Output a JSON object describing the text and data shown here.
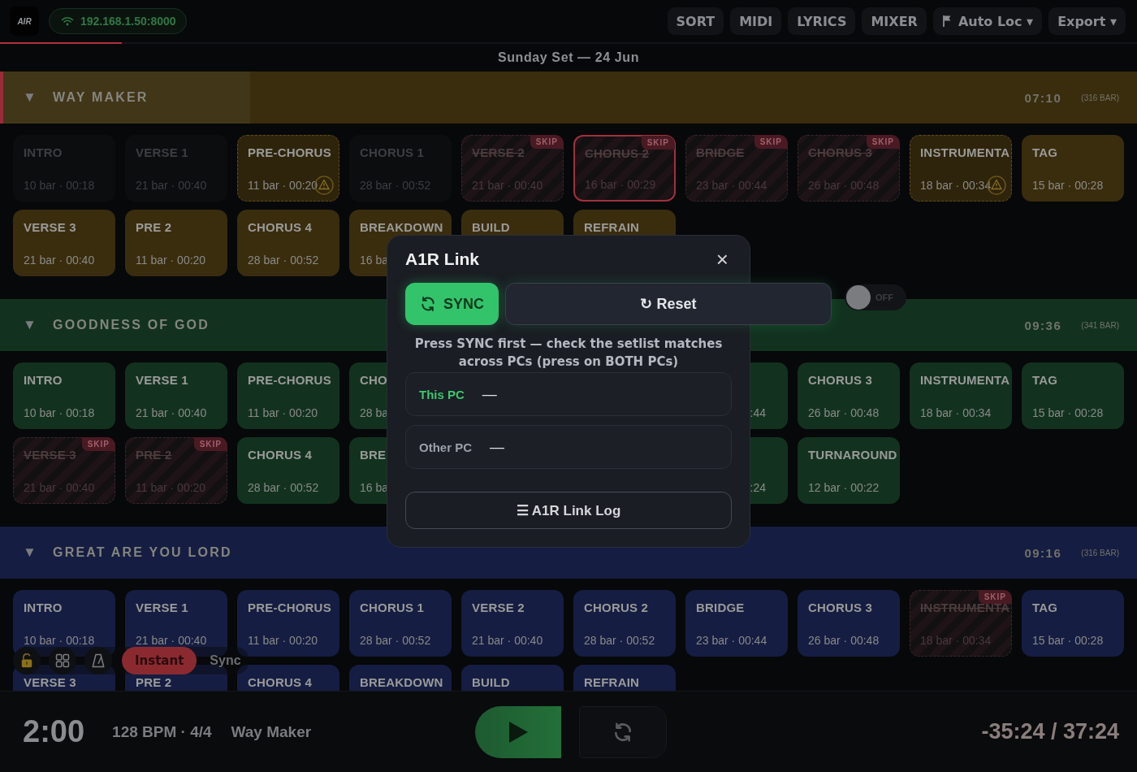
{
  "topbar": {
    "logo": "AIR",
    "address": "192.168.1.50:8000",
    "buttons": [
      {
        "label": "SORT",
        "kind": "plain"
      },
      {
        "label": "MIDI",
        "kind": "plain"
      },
      {
        "label": "LYRICS",
        "kind": "plain"
      },
      {
        "label": "MIXER",
        "kind": "plain"
      },
      {
        "label": "Auto Loc ▾",
        "kind": "flag"
      },
      {
        "label": "Export ▾",
        "kind": "plain"
      }
    ]
  },
  "progress": {
    "level": 0.107
  },
  "set_title": "Sunday Set — 24 Jun",
  "sections": [
    {
      "arrow": "▼",
      "title": "WAY MAKER",
      "time": "07:10",
      "bars": "(316 BAR)",
      "color": "#3a2d0e",
      "selected": true,
      "level": 0.218,
      "rows": [
        [
          {
            "title": "INTRO",
            "meta": "10 bar · 00:18",
            "kind": "played",
            "selected": false
          },
          {
            "title": "VERSE 1",
            "meta": "21 bar · 00:40",
            "kind": "played",
            "selected": false
          },
          {
            "title": "PRE-CHORUS",
            "meta": "11 bar · 00:20",
            "kind": "warning",
            "selected": false
          },
          {
            "title": "CHORUS 1",
            "meta": "28 bar · 00:52",
            "kind": "played",
            "selected": false
          },
          {
            "title": "VERSE 2",
            "meta": "21 bar · 00:40",
            "kind": "skip",
            "badge": "SKIP",
            "selected": false
          },
          {
            "title": "CHORUS 2",
            "meta": "16 bar · 00:29",
            "kind": "skip",
            "badge": "SKIP",
            "selected": true
          },
          {
            "title": "BRIDGE",
            "meta": "23 bar · 00:44",
            "kind": "skip",
            "badge": "SKIP",
            "selected": false
          },
          {
            "title": "CHORUS 3",
            "meta": "26 bar · 00:48",
            "kind": "skip",
            "badge": "SKIP",
            "selected": false
          },
          {
            "title": "INSTRUMENTA",
            "meta": "18 bar · 00:34",
            "kind": "warning",
            "selected": false
          },
          {
            "title": "TAG",
            "meta": "15 bar · 00:28",
            "kind": "normal",
            "selected": false
          }
        ],
        [
          {
            "title": "VERSE 3",
            "meta": "21 bar · 00:40",
            "kind": "normal",
            "selected": false
          },
          {
            "title": "PRE 2",
            "meta": "11 bar · 00:20",
            "kind": "normal",
            "selected": false
          },
          {
            "title": "CHORUS 4",
            "meta": "28 bar · 00:52",
            "kind": "normal",
            "selected": false
          },
          {
            "title": "BREAKDOWN",
            "meta": "16 ba",
            "kind": "normal",
            "selected": false
          },
          {
            "title": "BUILD",
            "kind": "normal",
            "selected": false
          },
          {
            "title": "REFRAIN",
            "kind": "normal",
            "selected": false
          }
        ]
      ]
    },
    {
      "arrow": "▼",
      "title": "GOODNESS OF GOD",
      "time": "09:36",
      "bars": "(341 BAR)",
      "color": "#12321f",
      "selected": false,
      "rows": [
        [
          {
            "title": "INTRO",
            "meta": "10 bar · 00:18",
            "kind": "normal",
            "selected": false
          },
          {
            "title": "VERSE 1",
            "meta": "21 bar · 00:40",
            "kind": "normal",
            "selected": false
          },
          {
            "title": "PRE-CHORUS",
            "meta": "11 bar · 00:20",
            "kind": "normal",
            "selected": false
          },
          {
            "title": "CHO",
            "meta": "28 ba",
            "kind": "normal",
            "selected": false
          },
          {
            "kind": "hidden"
          },
          {
            "kind": "hidden"
          },
          {
            "meta": ":44",
            "kind": "edge",
            "selected": false
          },
          {
            "title": "CHORUS 3",
            "meta": "26 bar · 00:48",
            "kind": "normal",
            "selected": false
          },
          {
            "title": "INSTRUMENTA",
            "meta": "18 bar · 00:34",
            "kind": "normal",
            "selected": false
          },
          {
            "title": "TAG",
            "meta": "15 bar · 00:28",
            "kind": "normal",
            "selected": false
          }
        ],
        [
          {
            "title": "VERSE 3",
            "meta": "21 bar · 00:40",
            "kind": "skip",
            "badge": "SKIP",
            "selected": false
          },
          {
            "title": "PRE 2",
            "meta": "11 bar · 00:20",
            "kind": "skip",
            "badge": "SKIP",
            "selected": false
          },
          {
            "title": "CHORUS 4",
            "meta": "28 bar · 00:52",
            "kind": "normal",
            "selected": false
          },
          {
            "title": "BRE",
            "meta": "16 ba",
            "kind": "normal",
            "selected": false
          },
          {
            "kind": "hidden"
          },
          {
            "kind": "hidden"
          },
          {
            "meta": ":24",
            "kind": "edge",
            "selected": false
          },
          {
            "title": "TURNAROUND",
            "meta": "12 bar · 00:22",
            "kind": "normal",
            "selected": false
          }
        ]
      ]
    },
    {
      "arrow": "▼",
      "title": "GREAT ARE YOU LORD",
      "time": "09:16",
      "bars": "(316 BAR)",
      "color": "#151d42",
      "selected": false,
      "rows": [
        [
          {
            "title": "INTRO",
            "meta": "10 bar · 00:18",
            "kind": "normal",
            "selected": false
          },
          {
            "title": "VERSE 1",
            "meta": "21 bar · 00:40",
            "kind": "normal",
            "selected": false
          },
          {
            "title": "PRE-CHORUS",
            "meta": "11 bar · 00:20",
            "kind": "normal",
            "selected": false
          },
          {
            "title": "CHORUS 1",
            "meta": "28 bar · 00:52",
            "kind": "normal",
            "selected": false
          },
          {
            "title": "VERSE 2",
            "meta": "21 bar · 00:40",
            "kind": "normal",
            "selected": false
          },
          {
            "title": "CHORUS 2",
            "meta": "28 bar · 00:52",
            "kind": "normal",
            "selected": false
          },
          {
            "title": "BRIDGE",
            "meta": "23 bar · 00:44",
            "kind": "normal",
            "selected": false
          },
          {
            "title": "CHORUS 3",
            "meta": "26 bar · 00:48",
            "kind": "normal",
            "selected": false
          },
          {
            "title": "INSTRUMENTA",
            "meta": "18 bar · 00:34",
            "kind": "skip",
            "badge": "SKIP",
            "selected": false
          },
          {
            "title": "TAG",
            "meta": "15 bar · 00:28",
            "kind": "normal",
            "selected": false
          }
        ],
        [
          {
            "title": "VERSE 3",
            "kind": "normal",
            "selected": false
          },
          {
            "title": "PRE 2",
            "kind": "normal",
            "selected": false
          },
          {
            "title": "CHORUS 4",
            "kind": "normal",
            "selected": false
          },
          {
            "title": "BREAKDOWN",
            "kind": "normal",
            "selected": false
          },
          {
            "title": "BUILD",
            "kind": "normal",
            "selected": false
          },
          {
            "title": "REFRAIN",
            "kind": "normal",
            "selected": false
          }
        ]
      ]
    }
  ],
  "floating_toolbar": {
    "buttons": [
      {
        "kind": "lock"
      },
      {
        "kind": "grid"
      },
      {
        "kind": "metronome"
      }
    ],
    "mode": "Instant",
    "sync_label": "Sync"
  },
  "transport": {
    "position": "2:00",
    "tempo": "128 BPM · 4/4",
    "song": "Way Maker",
    "time": "-35:24 / 37:24"
  },
  "modal": {
    "title": "A1R Link",
    "close": "×",
    "sync_button": "SYNC",
    "reset_button": "↻ Reset",
    "message": "Press SYNC first — check the setlist matches across PCs (press on BOTH PCs)",
    "rows": [
      {
        "label": "This PC",
        "value": "—",
        "color": "#3cc86a"
      },
      {
        "label": "Other PC",
        "value": "—",
        "color": "#9aa0a8"
      }
    ],
    "log_button": "☰ A1R Link Log"
  },
  "toggle": {
    "on": false,
    "label": "OFF"
  }
}
